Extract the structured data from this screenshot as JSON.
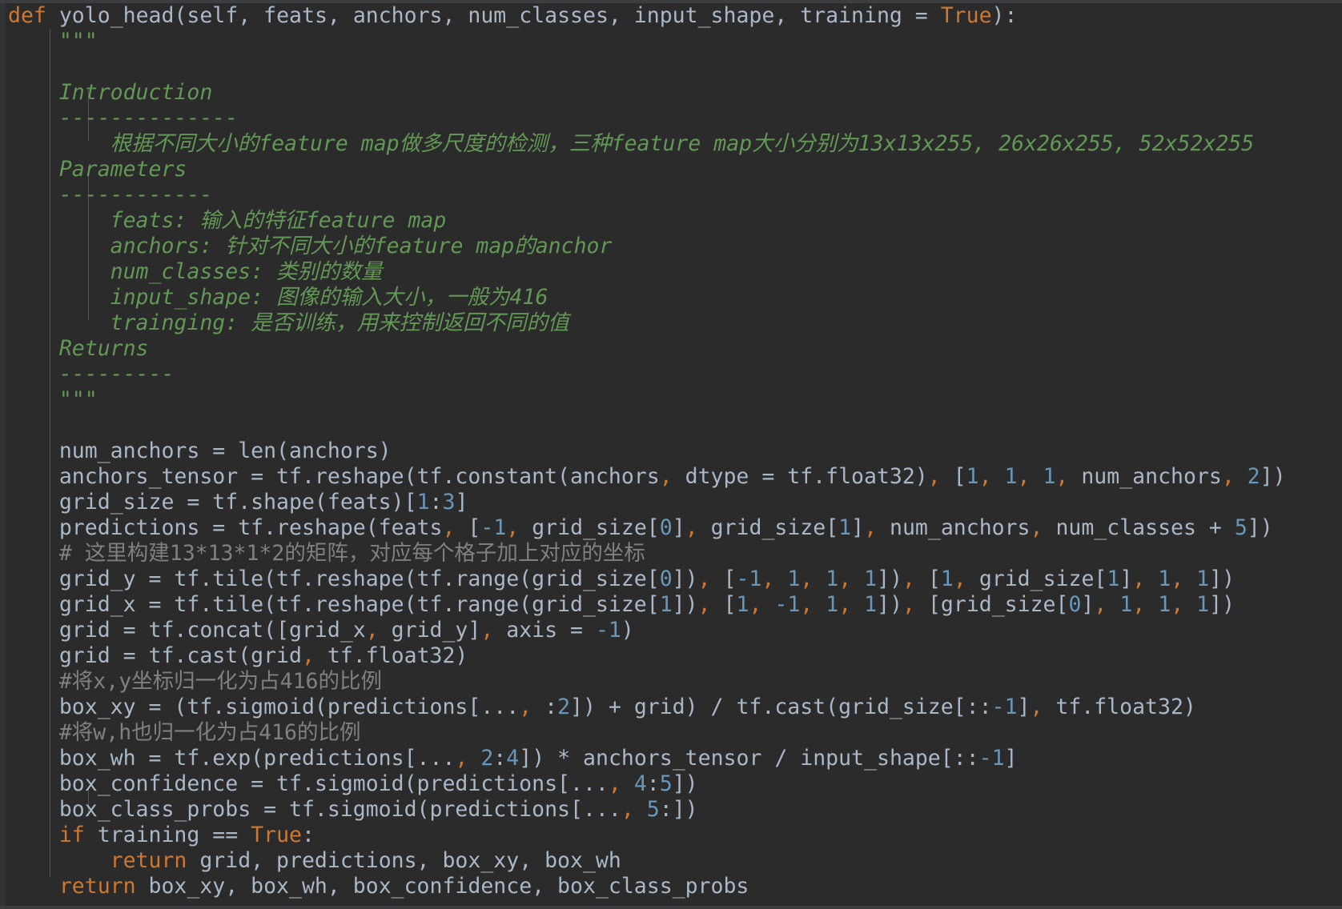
{
  "editor": {
    "language": "Python",
    "theme": "darcula",
    "background_color": "#2b2b2b",
    "default_text_color": "#a9b7c6",
    "keyword_color": "#cc7832",
    "number_color": "#6897bb",
    "comment_color": "#808080",
    "docstring_color": "#629755",
    "indent_guide_color": "#4e5254"
  },
  "code": {
    "signature": {
      "def_keyword": "def",
      "function_name": "yolo_head",
      "open_paren": "(",
      "params": "self, feats, anchors, num_classes, input_shape, training = ",
      "default_value": "True",
      "close": "):"
    },
    "docstring": {
      "open_quotes": "\"\"\"",
      "section_intro_title": "Introduction",
      "section_intro_rule": "--------------",
      "intro_body": "根据不同大小的feature map做多尺度的检测，三种feature map大小分别为13x13x255, 26x26x255, 52x52x255",
      "section_params_title": "Parameters",
      "section_params_rule": "------------",
      "param_feats": "feats: 输入的特征feature map",
      "param_anchors": "anchors: 针对不同大小的feature map的anchor",
      "param_num_classes": "num_classes: 类别的数量",
      "param_input_shape": "input_shape: 图像的输入大小，一般为416",
      "param_trainging": "trainging: 是否训练，用来控制返回不同的值",
      "section_returns_title": "Returns",
      "section_returns_rule": "---------",
      "close_quotes": "\"\"\""
    },
    "body": {
      "line_num_anchors": "num_anchors = len(anchors)",
      "line_anchors_tensor": "anchors_tensor = tf.reshape(tf.constant(anchors, dtype = tf.float32), [1, 1, 1, num_anchors, 2])",
      "line_grid_size": "grid_size = tf.shape(feats)[1:3]",
      "line_predictions": "predictions = tf.reshape(feats, [-1, grid_size[0], grid_size[1], num_anchors, num_classes + 5])",
      "comment_matrix": "# 这里构建13*13*1*2的矩阵，对应每个格子加上对应的坐标",
      "line_grid_y": "grid_y = tf.tile(tf.reshape(tf.range(grid_size[0]), [-1, 1, 1, 1]), [1, grid_size[1], 1, 1])",
      "line_grid_x": "grid_x = tf.tile(tf.reshape(tf.range(grid_size[1]), [1, -1, 1, 1]), [grid_size[0], 1, 1, 1])",
      "line_grid_concat": "grid = tf.concat([grid_x, grid_y], axis = -1)",
      "line_grid_cast": "grid = tf.cast(grid, tf.float32)",
      "comment_xy": "#将x,y坐标归一化为占416的比例",
      "line_box_xy": "box_xy = (tf.sigmoid(predictions[..., :2]) + grid) / tf.cast(grid_size[::-1], tf.float32)",
      "comment_wh": "#将w,h也归一化为占416的比例",
      "line_box_wh": "box_wh = tf.exp(predictions[..., 2:4]) * anchors_tensor / input_shape[::-1]",
      "line_box_confidence": "box_confidence = tf.sigmoid(predictions[..., 4:5])",
      "line_box_class_probs": "box_class_probs = tf.sigmoid(predictions[..., 5:])",
      "if_keyword": "if",
      "if_condition": " training == ",
      "if_true": "True",
      "if_colon": ":",
      "return_keyword_inner": "return",
      "return_values_inner": " grid, predictions, box_xy, box_wh",
      "return_keyword_outer": "return",
      "return_values_outer": " box_xy, box_wh, box_confidence, box_class_probs"
    }
  }
}
